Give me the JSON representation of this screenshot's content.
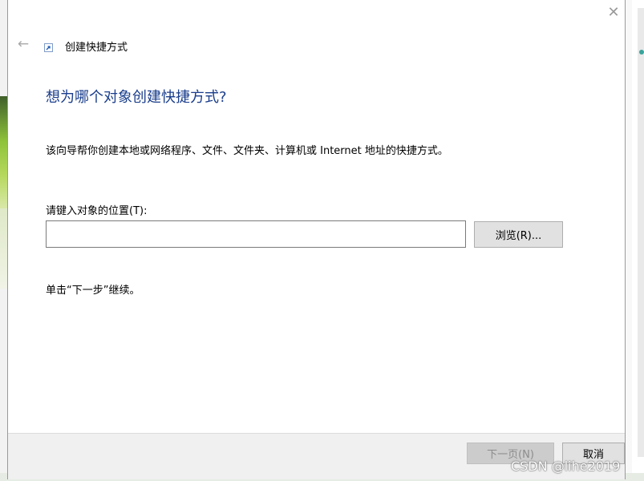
{
  "window": {
    "close_glyph": "✕",
    "back_glyph": "←",
    "title": "创建快捷方式"
  },
  "content": {
    "heading": "想为哪个对象创建快捷方式?",
    "description": "该向导帮你创建本地或网络程序、文件、文件夹、计算机或 Internet 地址的快捷方式。",
    "location_label": "请键入对象的位置(T):",
    "location_value": "",
    "location_placeholder": "",
    "browse_label": "浏览(R)...",
    "hint": "单击“下一步”继续。"
  },
  "footer": {
    "next_label": "下一页(N)",
    "cancel_label": "取消"
  },
  "watermark": "CSDN @lihe2019",
  "colors": {
    "heading": "#1a3e8c",
    "window_bg": "#ffffff",
    "footer_bg": "#f0f0f0",
    "button_bg": "#e1e1e1",
    "button_disabled_bg": "#cccccc"
  },
  "icons": {
    "shortcut": "shortcut-arrow-icon",
    "back": "back-arrow-icon",
    "close": "close-icon"
  }
}
